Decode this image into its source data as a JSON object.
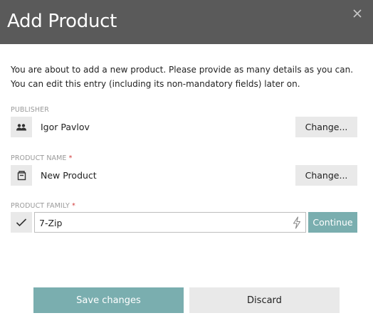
{
  "dialog": {
    "title": "Add Product",
    "close_icon": "close-icon",
    "intro_line1": "You are about to add a new product. Please provide as many details as you can.",
    "intro_line2": "You can edit this entry (including its non-mandatory fields) later on."
  },
  "publisher": {
    "label": "PUBLISHER",
    "icon": "users-icon",
    "value": "Igor Pavlov",
    "change_label": "Change..."
  },
  "product_name": {
    "label": "PRODUCT NAME",
    "required_mark": "*",
    "icon": "product-box-icon",
    "value": "New Product",
    "change_label": "Change..."
  },
  "product_family": {
    "label": "PRODUCT FAMILY",
    "required_mark": "*",
    "icon": "checkmark-icon",
    "value": "7-Zip",
    "input_icon": "lightning-icon",
    "continue_label": "Continue"
  },
  "footer": {
    "save_label": "Save changes",
    "discard_label": "Discard"
  },
  "colors": {
    "header_bg": "#5a5a5a",
    "accent": "#7aaeaf",
    "secondary_button_bg": "#e9e9e9",
    "required": "#d23c3c",
    "field_label": "#9a9a9a"
  }
}
